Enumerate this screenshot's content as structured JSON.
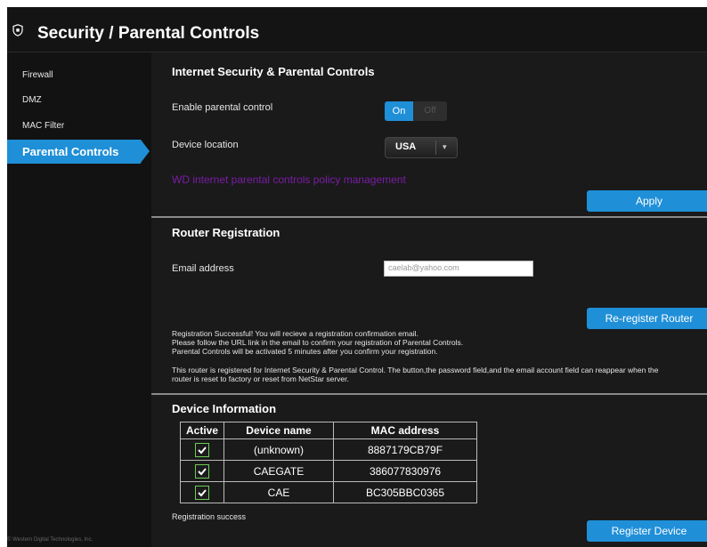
{
  "header": {
    "icon": "shield-icon",
    "title": "Security / Parental Controls"
  },
  "sidebar": {
    "items": [
      {
        "label": "Firewall",
        "active": false
      },
      {
        "label": "DMZ",
        "active": false
      },
      {
        "label": "MAC Filter",
        "active": false
      },
      {
        "label": "Parental Controls",
        "active": true
      }
    ]
  },
  "security": {
    "heading": "Internet Security & Parental Controls",
    "enable_label": "Enable parental control",
    "toggle": {
      "on": "On",
      "off": "Off",
      "value": "On"
    },
    "location_label": "Device location",
    "location_value": "USA",
    "policy_link": "WD internet parental controls policy management",
    "apply_label": "Apply"
  },
  "registration": {
    "heading": "Router Registration",
    "email_label": "Email address",
    "email_value": "caelab@yahoo.com",
    "reregister_label": "Re-register Router",
    "message_line1": "Registration Successful! You will recieve a registration confirmation email.",
    "message_line2": "Please follow the URL link in the email to confirm your registration of Parental Controls.",
    "message_line3": "Parental Controls will be activated 5 minutes after you confirm your registration.",
    "note_line1": "This router is registered for Internet Security & Parental Control. The button,the password field,and the email account field can reappear when the",
    "note_line2": "router is reset to factory or reset from NetStar server."
  },
  "devices": {
    "heading": "Device Information",
    "columns": [
      "Active",
      "Device name",
      "MAC address"
    ],
    "rows": [
      {
        "active": true,
        "name": "(unknown)",
        "mac": "8887179CB79F"
      },
      {
        "active": true,
        "name": "CAEGATE",
        "mac": "386077830976"
      },
      {
        "active": true,
        "name": "CAE",
        "mac": "BC305BBC0365"
      }
    ],
    "status": "Registration success",
    "register_label": "Register Device"
  },
  "footer": {
    "copyright": "© Western Digital Technologies, Inc."
  },
  "colors": {
    "accent": "#1f8fd8",
    "background": "#1a1a1a",
    "link": "#7a1ca6",
    "checkbox": "#6acd54"
  }
}
